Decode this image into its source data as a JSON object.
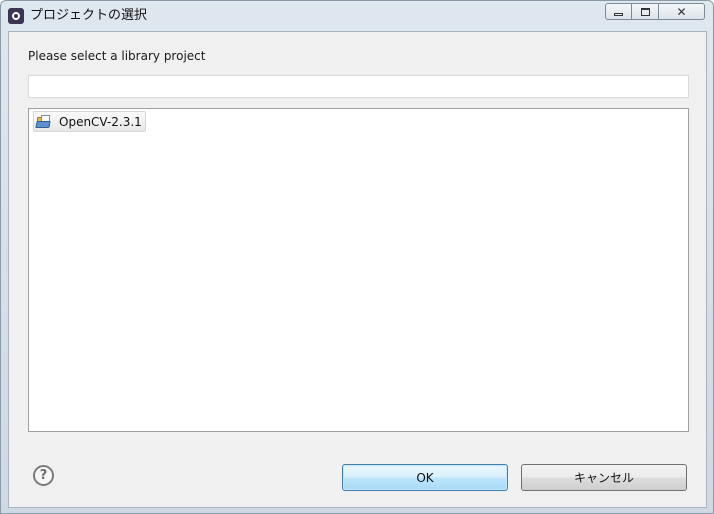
{
  "window": {
    "title": "プロジェクトの選択",
    "controls": {
      "minimize": "",
      "maximize": "",
      "close": "✕"
    }
  },
  "dialog": {
    "prompt": "Please select a library project",
    "filter": {
      "value": "",
      "placeholder": ""
    },
    "projects": [
      {
        "label": "OpenCV-2.3.1",
        "icon": "project-folder-icon"
      }
    ]
  },
  "footer": {
    "help_glyph": "?",
    "ok_label": "OK",
    "cancel_label": "キャンセル"
  },
  "colors": {
    "ok_border": "#3c7fb1",
    "ok_fill": "#bee6fd",
    "client_bg": "#f0f0f0"
  }
}
